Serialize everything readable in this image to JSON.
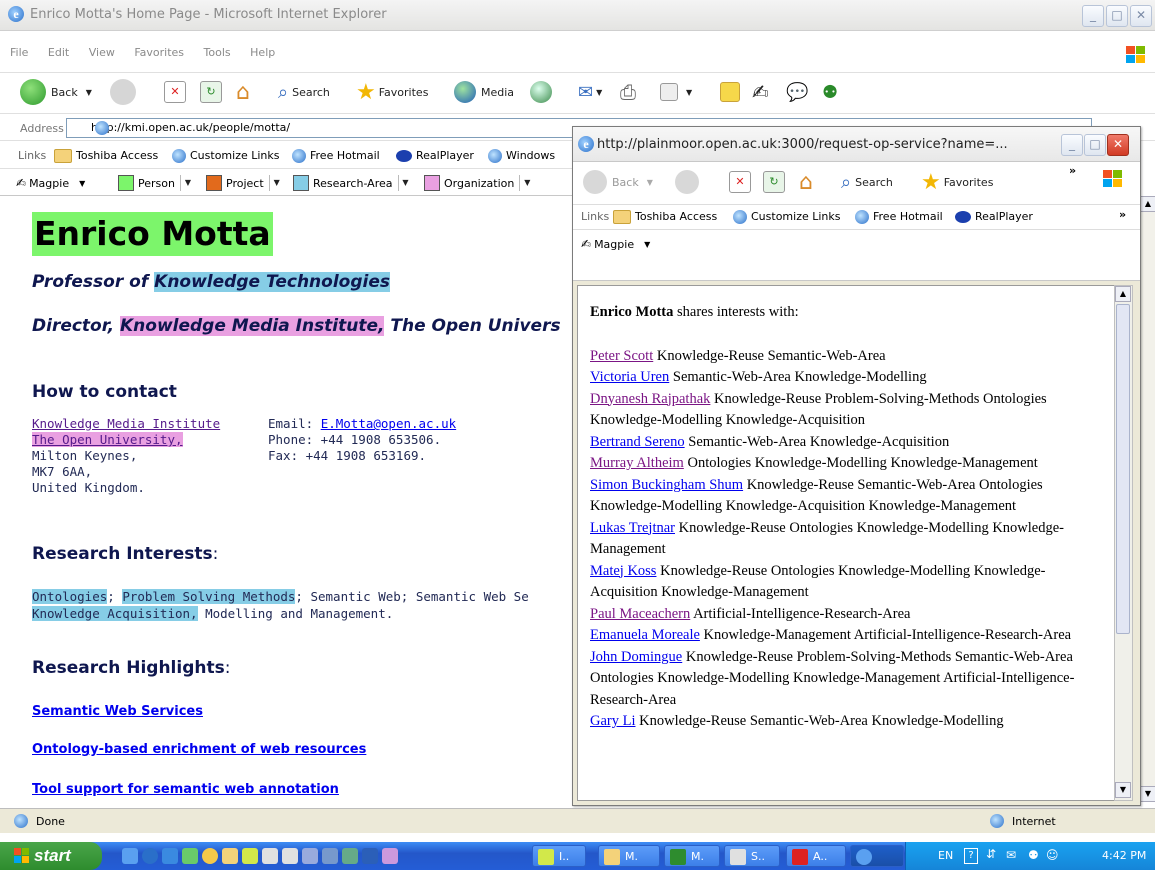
{
  "window": {
    "title": "Enrico Motta's Home Page - Microsoft Internet Explorer",
    "menu": [
      "File",
      "Edit",
      "View",
      "Favorites",
      "Tools",
      "Help"
    ],
    "toolbar": {
      "back": "Back",
      "search": "Search",
      "favorites": "Favorites",
      "media": "Media"
    },
    "address_label": "Address",
    "address": "http://kmi.open.ac.uk/people/motta/",
    "go": "Go",
    "links_label": "Links",
    "links": [
      "Toshiba Access",
      "Customize Links",
      "Free Hotmail",
      "RealPlayer",
      "Windows"
    ],
    "magpie": {
      "label": "Magpie",
      "categories": [
        {
          "label": "Person",
          "color": "#7cf56b"
        },
        {
          "label": "Project",
          "color": "#e26a1c"
        },
        {
          "label": "Research-Area",
          "color": "#86cde6"
        },
        {
          "label": "Organization",
          "color": "#e9a0e1"
        }
      ]
    },
    "status": "Done",
    "zone": "Internet"
  },
  "page": {
    "name": "Enrico Motta",
    "role1_prefix": "Professor of ",
    "role1_highlight": "Knowledge Technologies",
    "role2_prefix": "Director, ",
    "role2_highlight": "Knowledge Media Institute,",
    "role2_suffix": " The Open Univers",
    "contact_heading": "How to contact",
    "address_lines": [
      "Knowledge Media Institute",
      "The Open University,",
      "Milton Keynes,",
      "MK7 6AA,",
      "United Kingdom."
    ],
    "email_label": "Email: ",
    "email": "E.Motta@open.ac.uk",
    "phone": "Phone: +44 1908 653506.",
    "fax": "Fax: +44 1908 653169.",
    "interests_heading": "Research Interests",
    "interests_colon": ":",
    "interests": {
      "t1": "Ontologies",
      "t2": "; ",
      "t3": "Problem Solving Methods",
      "t4": "; Semantic Web; Semantic Web Se",
      "t5": "Knowledge Acquisition,",
      "t6": " Modelling and Management."
    },
    "highlights_heading": "Research Highlights",
    "highlights_colon": ":",
    "highlights": [
      "Semantic Web Services",
      "Ontology-based enrichment of web resources",
      "Tool support for semantic web annotation"
    ]
  },
  "popup": {
    "title": "http://plainmoor.open.ac.uk:3000/request-op-service?name=...",
    "toolbar": {
      "back": "Back",
      "search": "Search",
      "favorites": "Favorites"
    },
    "links_label": "Links",
    "links": [
      "Toshiba Access",
      "Customize Links",
      "Free Hotmail",
      "RealPlayer"
    ],
    "magpie_label": "Magpie",
    "intro_name": "Enrico Motta",
    "intro_text": " shares interests with:",
    "people": [
      {
        "name": "Peter Scott",
        "interests": " Knowledge-Reuse Semantic-Web-Area",
        "visited": true
      },
      {
        "name": "Victoria Uren",
        "interests": " Semantic-Web-Area Knowledge-Modelling",
        "visited": false
      },
      {
        "name": "Dnyanesh Rajpathak",
        "interests": " Knowledge-Reuse Problem-Solving-Methods Ontologies Knowledge-Modelling Knowledge-Acquisition",
        "visited": true
      },
      {
        "name": "Bertrand Sereno",
        "interests": " Semantic-Web-Area Knowledge-Acquisition",
        "visited": false
      },
      {
        "name": "Murray Altheim",
        "interests": " Ontologies Knowledge-Modelling Knowledge-Management",
        "visited": true
      },
      {
        "name": "Simon Buckingham Shum",
        "interests": " Knowledge-Reuse Semantic-Web-Area Ontologies Knowledge-Modelling Knowledge-Acquisition Knowledge-Management",
        "visited": false
      },
      {
        "name": "Lukas Trejtnar",
        "interests": " Knowledge-Reuse Ontologies Knowledge-Modelling Knowledge-Management",
        "visited": false
      },
      {
        "name": "Matej Koss",
        "interests": " Knowledge-Reuse Ontologies Knowledge-Modelling Knowledge-Acquisition Knowledge-Management",
        "visited": false
      },
      {
        "name": "Paul Maceachern",
        "interests": " Artificial-Intelligence-Research-Area",
        "visited": true
      },
      {
        "name": "Emanuela Moreale",
        "interests": " Knowledge-Management Artificial-Intelligence-Research-Area",
        "visited": false
      },
      {
        "name": "John Domingue",
        "interests": " Knowledge-Reuse Problem-Solving-Methods Semantic-Web-Area Ontologies Knowledge-Modelling Knowledge-Management Artificial-Intelligence-Research-Area",
        "visited": false
      },
      {
        "name": "Gary Li",
        "interests": " Knowledge-Reuse Semantic-Web-Area Knowledge-Modelling",
        "visited": false
      }
    ]
  },
  "taskbar": {
    "start": "start",
    "tasks": [
      "I..",
      "M.",
      "M.",
      "S..",
      "A.."
    ],
    "lang": "EN",
    "clock": "4:42 PM"
  }
}
